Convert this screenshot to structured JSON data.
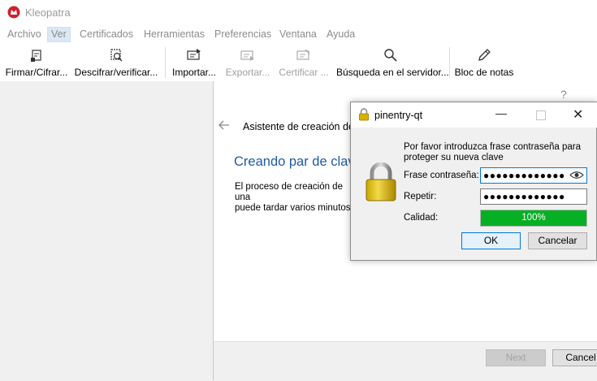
{
  "window": {
    "title": "Kleopatra"
  },
  "menu": {
    "items": [
      {
        "label": "Archivo"
      },
      {
        "label": "Ver"
      },
      {
        "label": "Certificados"
      },
      {
        "label": "Herramientas"
      },
      {
        "label": "Preferencias"
      },
      {
        "label": "Ventana"
      },
      {
        "label": "Ayuda"
      }
    ]
  },
  "toolbar": {
    "sign_encrypt": "Firmar/Cifrar...",
    "decrypt_verify": "Descifrar/verificar...",
    "import": "Importar...",
    "export": "Exportar...",
    "certify": "Certificar ...",
    "lookup": "Búsqueda en el servidor...",
    "notepad": "Bloc de notas"
  },
  "wizard": {
    "help": "?",
    "title": "Asistente de creación de",
    "heading": "Creando par de clave",
    "text_line1": "El proceso de creación de una",
    "text_line2": "puede tardar varios minutos.",
    "next_label": "Next",
    "cancel_label": "Cancel"
  },
  "pinentry": {
    "title": "pinentry-qt",
    "description": "Por favor introduzca frase contraseña para proteger su nueva clave",
    "passphrase_label": "Frase contraseña:",
    "passphrase_value": "●●●●●●●●●●●●●",
    "repeat_label": "Repetir:",
    "repeat_value": "●●●●●●●●●●●●●",
    "quality_label": "Calidad:",
    "quality_value": "100%",
    "quality_fraction": 1.0,
    "ok_label": "OK",
    "cancel_label": "Cancelar"
  },
  "colors": {
    "accent": "#0078d7",
    "quality_green": "#06b025",
    "heading_blue": "#1e5aa8"
  },
  "icons": [
    "kleopatra-logo-icon",
    "sign-encrypt-icon",
    "decrypt-verify-icon",
    "import-icon",
    "export-icon",
    "certify-icon",
    "search-icon",
    "pencil-icon",
    "back-arrow-icon",
    "lock-icon",
    "eye-icon"
  ]
}
